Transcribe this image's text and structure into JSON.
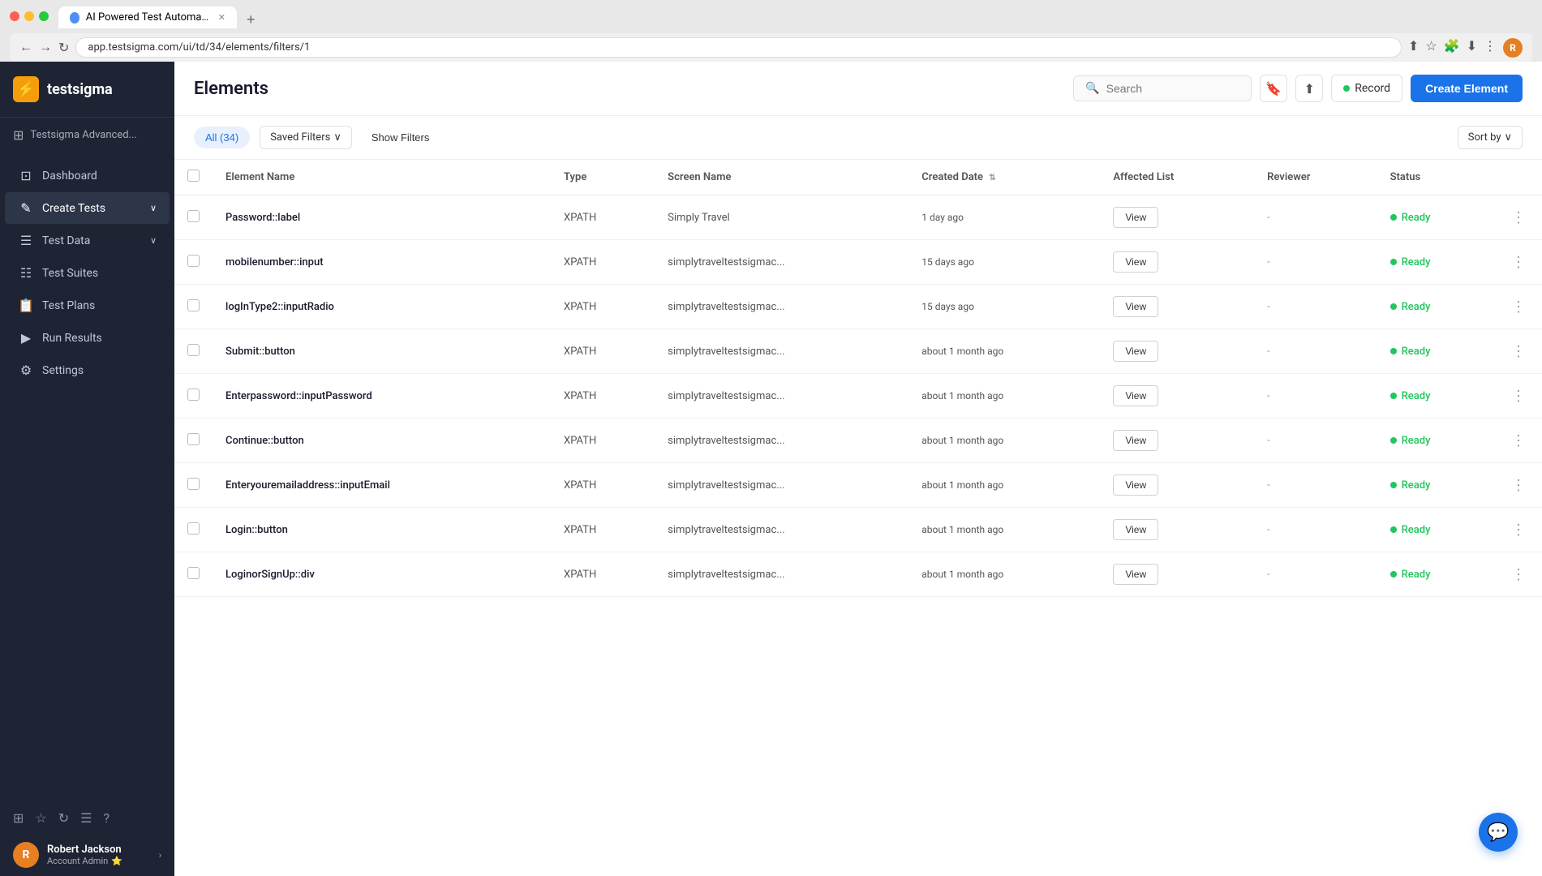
{
  "browser": {
    "tab_title": "AI Powered Test Automation P...",
    "tab_icon": "●",
    "url": "app.testsigma.com/ui/td/34/elements/filters/1",
    "new_tab": "+"
  },
  "sidebar": {
    "logo_text": "testsigma",
    "workspace": {
      "label": "Testsigma Advanced...",
      "icon": "⊞"
    },
    "nav_items": [
      {
        "id": "dashboard",
        "label": "Dashboard",
        "icon": "⊡"
      },
      {
        "id": "create-tests",
        "label": "Create Tests",
        "icon": "✎",
        "arrow": "∨"
      },
      {
        "id": "test-data",
        "label": "Test Data",
        "icon": "☰",
        "arrow": "∨"
      },
      {
        "id": "test-suites",
        "label": "Test Suites",
        "icon": "☷"
      },
      {
        "id": "test-plans",
        "label": "Test Plans",
        "icon": "📋"
      },
      {
        "id": "run-results",
        "label": "Run Results",
        "icon": "▶"
      },
      {
        "id": "settings",
        "label": "Settings",
        "icon": "⚙"
      }
    ],
    "tools": [
      "⊞",
      "☆",
      "↻",
      "☰",
      "?"
    ],
    "user": {
      "name": "Robert Jackson",
      "role": "Account Admin",
      "star": "⭐",
      "avatar_initial": "R"
    }
  },
  "header": {
    "title": "Elements",
    "search_placeholder": "Search",
    "record_label": "Record",
    "create_label": "Create Element"
  },
  "filters": {
    "all_label": "All (34)",
    "saved_filters_label": "Saved Filters",
    "show_filters_label": "Show Filters",
    "sort_by_label": "Sort by"
  },
  "table": {
    "columns": [
      "Element Name",
      "Type",
      "Screen Name",
      "Created Date",
      "Affected List",
      "Reviewer",
      "Status"
    ],
    "rows": [
      {
        "name": "Password::label",
        "type": "XPATH",
        "screen": "Simply Travel",
        "date": "1 day ago",
        "affected": "View",
        "reviewer": "-",
        "status": "Ready"
      },
      {
        "name": "mobilenumber::input",
        "type": "XPATH",
        "screen": "simplytraveltestsigmac...",
        "date": "15 days ago",
        "affected": "View",
        "reviewer": "-",
        "status": "Ready"
      },
      {
        "name": "logInType2::inputRadio",
        "type": "XPATH",
        "screen": "simplytraveltestsigmac...",
        "date": "15 days ago",
        "affected": "View",
        "reviewer": "-",
        "status": "Ready"
      },
      {
        "name": "Submit::button",
        "type": "XPATH",
        "screen": "simplytraveltestsigmac...",
        "date": "about 1 month ago",
        "affected": "View",
        "reviewer": "-",
        "status": "Ready"
      },
      {
        "name": "Enterpassword::inputPassword",
        "type": "XPATH",
        "screen": "simplytraveltestsigmac...",
        "date": "about 1 month ago",
        "affected": "View",
        "reviewer": "-",
        "status": "Ready"
      },
      {
        "name": "Continue::button",
        "type": "XPATH",
        "screen": "simplytraveltestsigmac...",
        "date": "about 1 month ago",
        "affected": "View",
        "reviewer": "-",
        "status": "Ready"
      },
      {
        "name": "Enteryouremailaddress::inputEmail",
        "type": "XPATH",
        "screen": "simplytraveltestsigmac...",
        "date": "about 1 month ago",
        "affected": "View",
        "reviewer": "-",
        "status": "Ready"
      },
      {
        "name": "Login::button",
        "type": "XPATH",
        "screen": "simplytraveltestsigmac...",
        "date": "about 1 month ago",
        "affected": "View",
        "reviewer": "-",
        "status": "Ready"
      },
      {
        "name": "LoginorSignUp::div",
        "type": "XPATH",
        "screen": "simplytraveltestsigmac...",
        "date": "about 1 month ago",
        "affected": "View",
        "reviewer": "-",
        "status": "Ready"
      }
    ]
  },
  "chat_icon": "💬",
  "colors": {
    "accent_blue": "#1a73e8",
    "green": "#22c55e",
    "sidebar_bg": "#1e2433"
  }
}
